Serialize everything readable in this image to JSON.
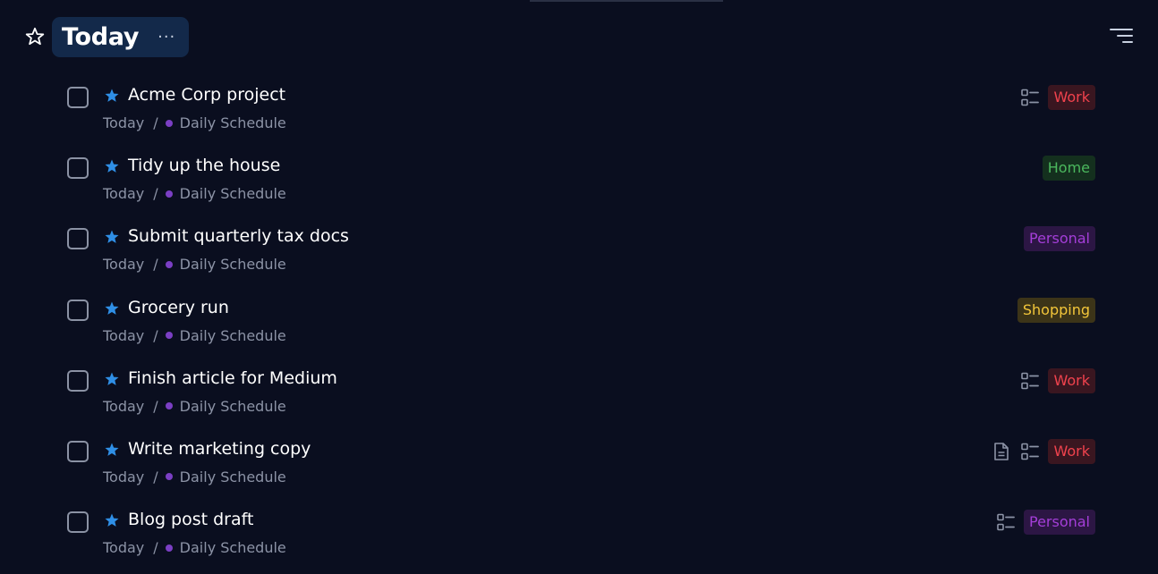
{
  "header": {
    "title": "Today",
    "more_label": "···"
  },
  "colors": {
    "work_text": "#f0424d",
    "work_bg": "#3a1620",
    "home_text": "#4bb85e",
    "home_bg": "#14301e",
    "personal_text": "#a43ed8",
    "personal_bg": "#2c1644",
    "shopping_text": "#f3c63a",
    "shopping_bg": "#3c3418",
    "star_blue": "#2f8fe6",
    "list_dot": "#7b3fc4"
  },
  "tasks": [
    {
      "title": "Acme Corp project",
      "date": "Today",
      "sep": "/",
      "list": "Daily Schedule",
      "tag": "Work",
      "tag_kind": "work",
      "icons": [
        "subtasks-icon"
      ]
    },
    {
      "title": "Tidy up the house",
      "date": "Today",
      "sep": "/",
      "list": "Daily Schedule",
      "tag": "Home",
      "tag_kind": "home",
      "icons": []
    },
    {
      "title": "Submit quarterly tax docs",
      "date": "Today",
      "sep": "/",
      "list": "Daily Schedule",
      "tag": "Personal",
      "tag_kind": "personal",
      "icons": []
    },
    {
      "title": "Grocery run",
      "date": "Today",
      "sep": "/",
      "list": "Daily Schedule",
      "tag": "Shopping",
      "tag_kind": "shopping",
      "icons": []
    },
    {
      "title": "Finish article for Medium",
      "date": "Today",
      "sep": "/",
      "list": "Daily Schedule",
      "tag": "Work",
      "tag_kind": "work",
      "icons": [
        "subtasks-icon"
      ]
    },
    {
      "title": "Write marketing copy",
      "date": "Today",
      "sep": "/",
      "list": "Daily Schedule",
      "tag": "Work",
      "tag_kind": "work",
      "icons": [
        "note-icon",
        "subtasks-icon"
      ]
    },
    {
      "title": "Blog post draft",
      "date": "Today",
      "sep": "/",
      "list": "Daily Schedule",
      "tag": "Personal",
      "tag_kind": "personal",
      "icons": [
        "subtasks-icon"
      ]
    }
  ]
}
